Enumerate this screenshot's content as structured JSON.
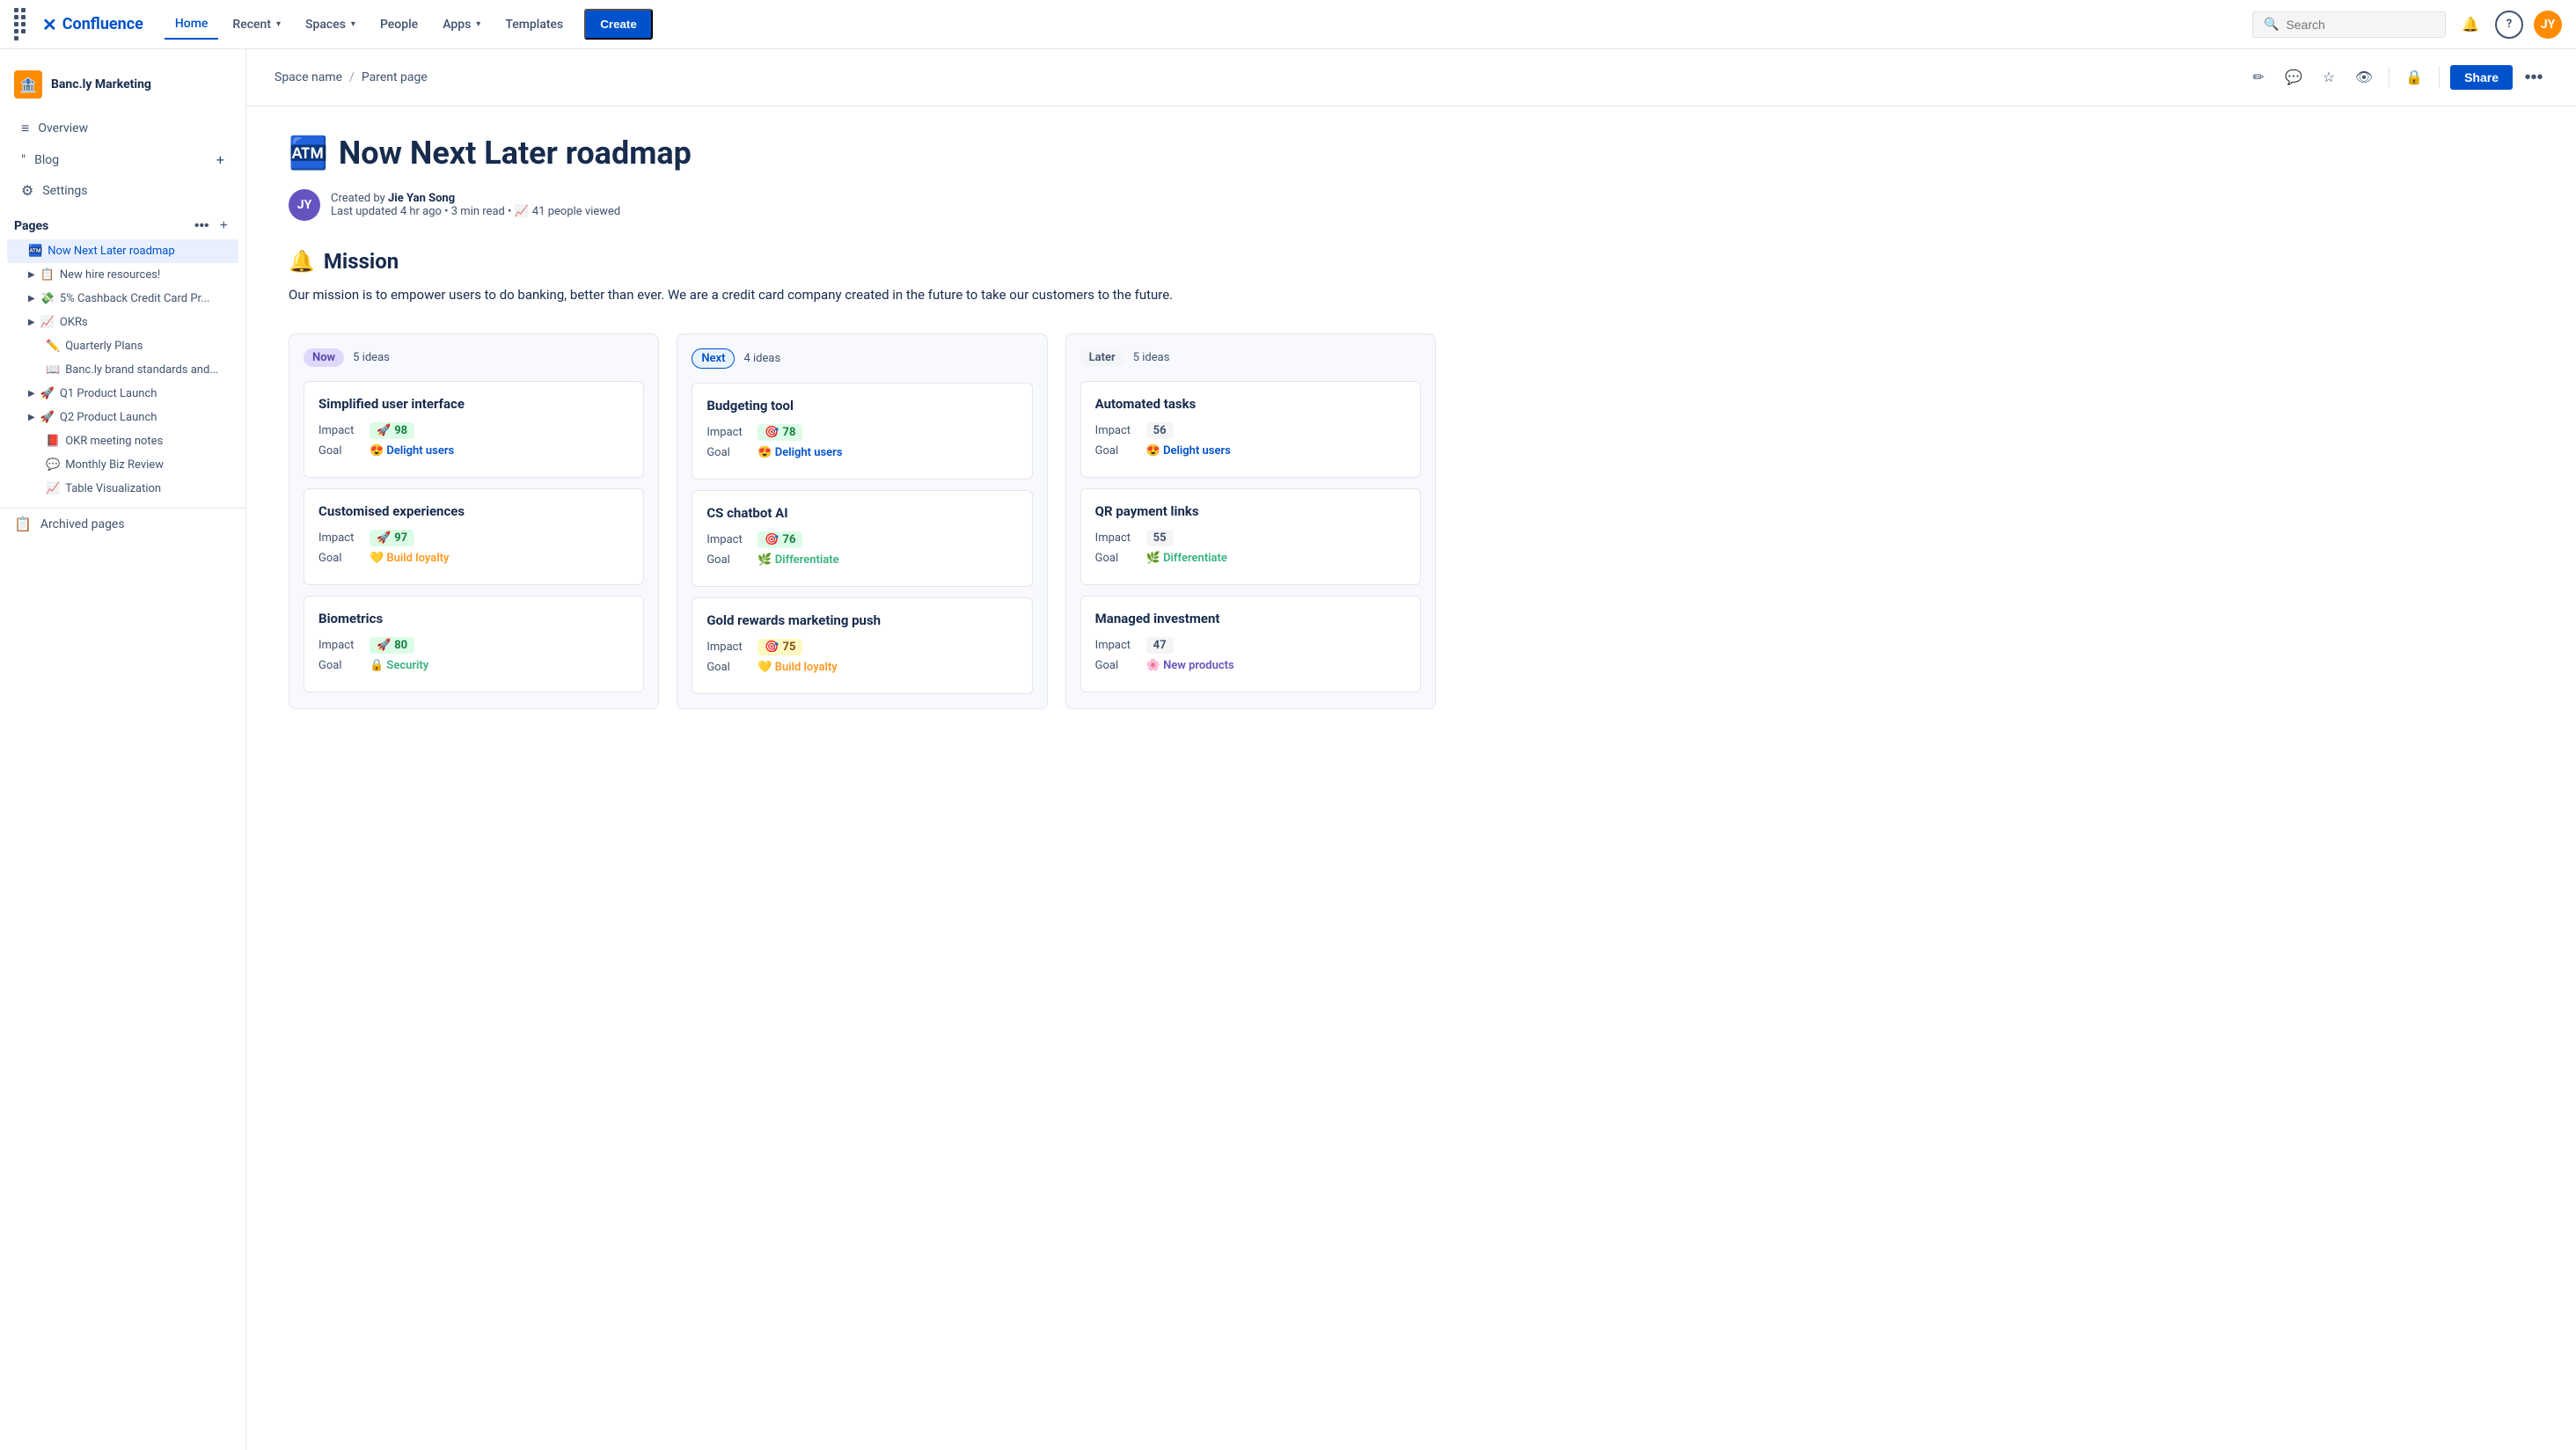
{
  "topnav": {
    "logo_text": "Confluence",
    "nav_items": [
      {
        "label": "Home",
        "active": true
      },
      {
        "label": "Recent",
        "has_dropdown": true
      },
      {
        "label": "Spaces",
        "has_dropdown": true
      },
      {
        "label": "People"
      },
      {
        "label": "Apps",
        "has_dropdown": true
      },
      {
        "label": "Templates"
      }
    ],
    "create_label": "Create",
    "search_placeholder": "Search"
  },
  "sidebar": {
    "space_name": "Banc.ly Marketing",
    "space_icon": "🏦",
    "nav": [
      {
        "icon": "≡",
        "label": "Overview"
      },
      {
        "icon": "❝",
        "label": "Blog"
      },
      {
        "icon": "⚙",
        "label": "Settings"
      }
    ],
    "pages_label": "Pages",
    "pages": [
      {
        "emoji": "🏧",
        "label": "Now Next Later roadmap",
        "active": true,
        "indent": 0
      },
      {
        "emoji": "📋",
        "label": "New hire resources!",
        "indent": 0,
        "has_children": true
      },
      {
        "emoji": "💸",
        "label": "5% Cashback Credit Card Pr...",
        "indent": 0,
        "has_children": true
      },
      {
        "emoji": "📈",
        "label": "OKRs",
        "indent": 0,
        "has_children": true
      },
      {
        "emoji": "✏️",
        "label": "Quarterly Plans",
        "indent": 0
      },
      {
        "emoji": "📖",
        "label": "Banc.ly brand standards and...",
        "indent": 0
      },
      {
        "emoji": "🚀",
        "label": "Q1 Product Launch",
        "indent": 0,
        "has_children": true
      },
      {
        "emoji": "🚀",
        "label": "Q2 Product Launch",
        "indent": 0,
        "has_children": true
      },
      {
        "emoji": "📕",
        "label": "OKR meeting notes",
        "indent": 0
      },
      {
        "emoji": "💬",
        "label": "Monthly Biz Review",
        "indent": 0
      },
      {
        "emoji": "📈",
        "label": "Table Visualization",
        "indent": 0
      }
    ],
    "archived_label": "Archived pages"
  },
  "page_header": {
    "breadcrumb_space": "Space name",
    "breadcrumb_parent": "Parent page"
  },
  "page": {
    "title_emoji": "🏧",
    "title": "Now Next Later roadmap",
    "author_name": "Jie Yan Song",
    "meta": "Created by Jie Yan Song",
    "last_updated": "Last updated 4 hr ago",
    "read_time": "3 min read",
    "views": "41 people viewed",
    "mission_emoji": "🔔",
    "mission_title": "Mission",
    "mission_text": "Our mission is to empower users to do banking, better than ever. We are a credit card company created in the future to take our customers to the future."
  },
  "roadmap": {
    "columns": [
      {
        "label": "Now",
        "badge_class": "badge-now",
        "ideas_count": "5 ideas",
        "cards": [
          {
            "title": "Simplified user interface",
            "impact": 98,
            "impact_emoji": "🚀",
            "impact_level": "high",
            "goal": "Delight users",
            "goal_emoji": "😍",
            "goal_class": "goal-delight"
          },
          {
            "title": "Customised experiences",
            "impact": 97,
            "impact_emoji": "🚀",
            "impact_level": "high",
            "goal": "Build loyalty",
            "goal_emoji": "💛",
            "goal_class": "goal-loyalty"
          },
          {
            "title": "Biometrics",
            "impact": 80,
            "impact_emoji": "🚀",
            "impact_level": "high",
            "goal": "Security",
            "goal_emoji": "🔒",
            "goal_class": "goal-security"
          }
        ]
      },
      {
        "label": "Next",
        "badge_class": "badge-next",
        "ideas_count": "4 ideas",
        "cards": [
          {
            "title": "Budgeting tool",
            "impact": 78,
            "impact_emoji": "🎯",
            "impact_level": "high",
            "goal": "Delight users",
            "goal_emoji": "😍",
            "goal_class": "goal-delight"
          },
          {
            "title": "CS chatbot AI",
            "impact": 76,
            "impact_emoji": "🎯",
            "impact_level": "high",
            "goal": "Differentiate",
            "goal_emoji": "🌿",
            "goal_class": "goal-differentiate"
          },
          {
            "title": "Gold rewards marketing push",
            "impact": 75,
            "impact_emoji": "🎯",
            "impact_level": "med",
            "goal": "Build loyalty",
            "goal_emoji": "💛",
            "goal_class": "goal-loyalty"
          }
        ]
      },
      {
        "label": "Later",
        "badge_class": "badge-later",
        "ideas_count": "5 ideas",
        "cards": [
          {
            "title": "Automated tasks",
            "impact": 56,
            "impact_emoji": "",
            "impact_level": "low",
            "goal": "Delight users",
            "goal_emoji": "😍",
            "goal_class": "goal-delight"
          },
          {
            "title": "QR payment links",
            "impact": 55,
            "impact_emoji": "",
            "impact_level": "low",
            "goal": "Differentiate",
            "goal_emoji": "🌿",
            "goal_class": "goal-differentiate"
          },
          {
            "title": "Managed investment",
            "impact": 47,
            "impact_emoji": "",
            "impact_level": "low",
            "goal": "New products",
            "goal_emoji": "🌸",
            "goal_class": "goal-new-products"
          }
        ]
      }
    ]
  },
  "icons": {
    "grid_icon": "⊞",
    "search_icon": "🔍",
    "bell_icon": "🔔",
    "help_icon": "?",
    "edit_icon": "✏",
    "comment_icon": "💬",
    "star_icon": "☆",
    "watch_icon": "👁",
    "lock_icon": "🔒",
    "more_icon": "•••"
  }
}
